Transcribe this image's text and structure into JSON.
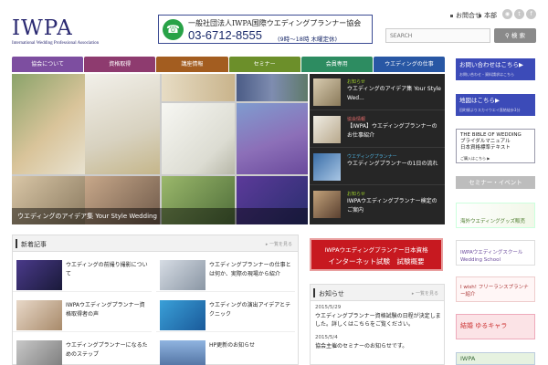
{
  "header": {
    "logo_main": "IWPA",
    "logo_sub": "International Wedding Professional Association",
    "phone_org": "一般社団法人IWPA国際ウエディングプランナー協会",
    "phone_number": "03-6712-8555",
    "phone_hours": "(9時～18時 木曜定休)",
    "top_links": [
      "お問合せ",
      "本部"
    ],
    "search_placeholder": "SEARCH",
    "search_button": "検 索"
  },
  "nav": [
    {
      "label": "協会について",
      "color": "#7d4ea0"
    },
    {
      "label": "資格取得",
      "color": "#8e3b6f"
    },
    {
      "label": "講座情報",
      "color": "#a35d20"
    },
    {
      "label": "セミナー",
      "color": "#6c8f2a"
    },
    {
      "label": "会員専用",
      "color": "#2d8c61"
    },
    {
      "label": "ウエディングの仕事",
      "color": "#2857a4"
    }
  ],
  "hero": {
    "caption": "ウエディングのアイデア集 Your Style Wedding"
  },
  "side_list": [
    {
      "category": "お知らせ",
      "category_color": "#9ccc2b",
      "title": "ウエディングのアイデア集 Your Style Wed..."
    },
    {
      "category": "協会情報",
      "category_color": "#e36a6a",
      "title": "【IWPA】ウエディングプランナーのお仕事紹介"
    },
    {
      "category": "ウエディングプランナー",
      "category_color": "#4fb3e0",
      "title": "ウエディングプランナーの1日の流れ"
    },
    {
      "category": "お知らせ",
      "category_color": "#9ccc2b",
      "title": "IWPAウエディングプランナー検定のご案内"
    }
  ],
  "right_banners": [
    {
      "text": "お問い合わせはこちら▶",
      "sub": "お問い合わせ・資料請求はこちら"
    },
    {
      "text": "地図はこちら▶",
      "sub": "田町駅よりスカイウエイ直結徒歩3分"
    },
    {
      "text": "THE BIBLE OF WEDDING\nブライダルマニュアル\n日本資格標準テキスト",
      "sub": "ご購入はこちら ▶"
    },
    {
      "text": "海外ウエディンググッズ販売",
      "sub": ""
    },
    {
      "text": "IWPAウエディングスクール Wedding School",
      "sub": ""
    },
    {
      "text": "I wish! フリーランスプランナー紹介",
      "sub": ""
    },
    {
      "text": "結婚 ゆるキャラ",
      "sub": ""
    },
    {
      "text": "IWPA",
      "sub": ""
    }
  ],
  "seminar_heading": "セミナー・イベント",
  "news_panel": {
    "title": "新着記事",
    "more": "一覧を見る",
    "items": [
      {
        "text": "ウエディングの前撮り撮影について"
      },
      {
        "text": "ウエディングプランナーの仕事とは何か、実際の現場から紹介"
      },
      {
        "text": "IWPAウエディングプランナー資格取得者の声"
      },
      {
        "text": "ウエディングの演出アイデアとテクニック"
      },
      {
        "text": "ウエディングプランナーになるためのステップ"
      },
      {
        "text": "HP更新のお知らせ"
      }
    ]
  },
  "exam_banner": {
    "line1": "IWPAウエディングプランナー日本資格",
    "line2": "インターネット試験　試験概要"
  },
  "notice_panel": {
    "title": "お知らせ",
    "more": "一覧を見る",
    "items": [
      {
        "date": "2015/5/29",
        "text": "ウエディングプランナー資格試験の日程が決定しました。詳しくはこちらをご覧ください。"
      },
      {
        "date": "2015/5/4",
        "text": "協会主催のセミナーのお知らせです。"
      }
    ]
  },
  "colors": {
    "brand_navy": "#2b2a72",
    "phone_green": "#28a247",
    "exam_red": "#c71920"
  }
}
